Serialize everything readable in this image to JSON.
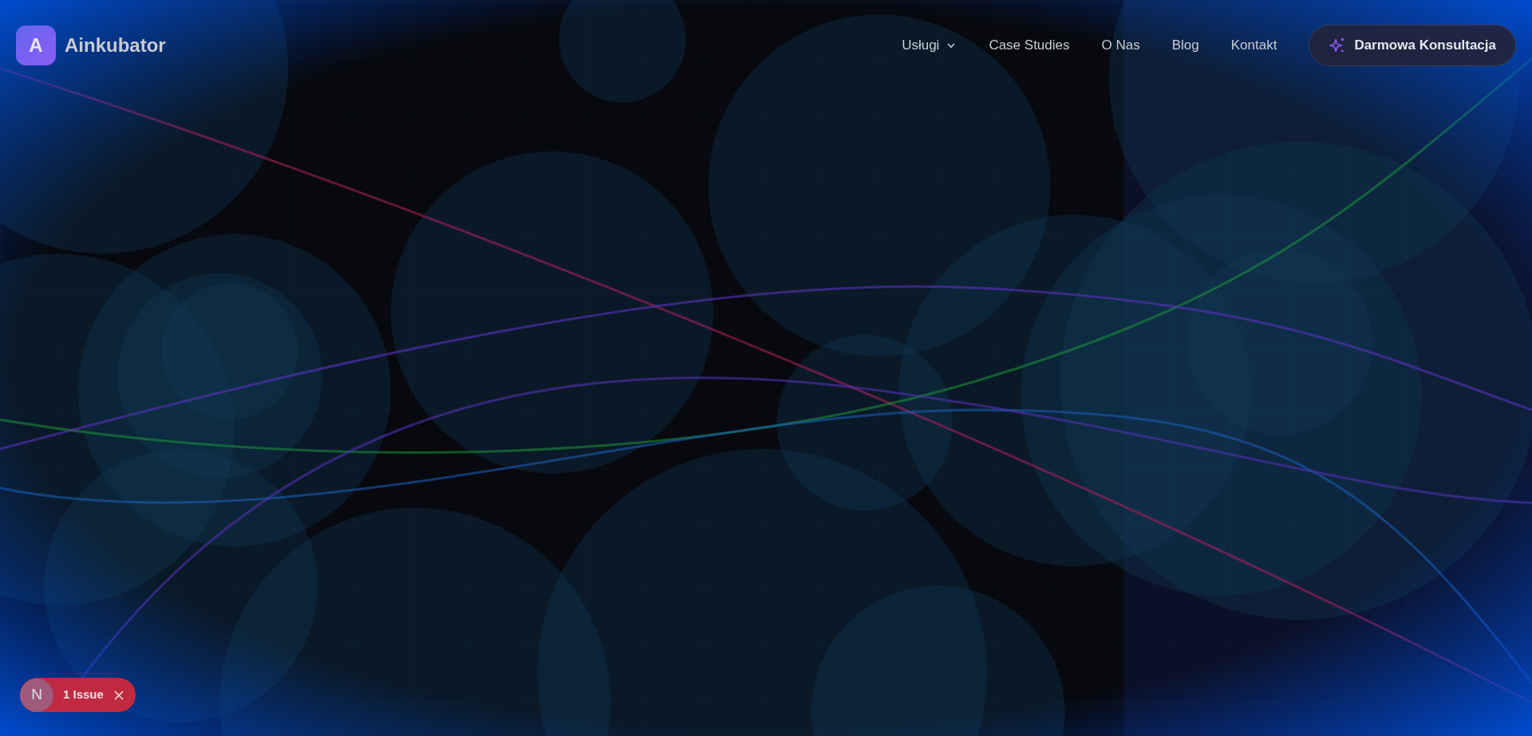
{
  "header": {
    "logo_letter": "A",
    "brand": "Ainkubator",
    "nav": [
      {
        "label": "Usługi",
        "dropdown": true
      },
      {
        "label": "Case Studies",
        "dropdown": false
      },
      {
        "label": "O Nas",
        "dropdown": false
      },
      {
        "label": "Blog",
        "dropdown": false
      },
      {
        "label": "Kontakt",
        "dropdown": false
      }
    ],
    "cta": "Darmowa Konsultacja"
  },
  "issue_badge": {
    "logo_letter": "N",
    "label": "1 Issue"
  }
}
